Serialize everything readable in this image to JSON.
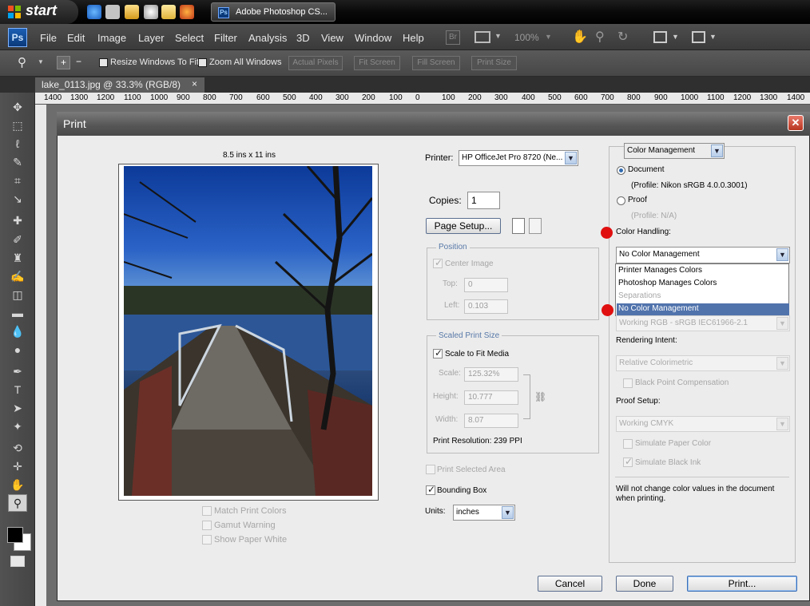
{
  "taskbar": {
    "start_label": "start",
    "task_label": "Adobe Photoshop CS...",
    "task_icon": "Ps"
  },
  "menubar": {
    "logo": "Ps",
    "items": [
      "File",
      "Edit",
      "Image",
      "Layer",
      "Select",
      "Filter",
      "Analysis",
      "3D",
      "View",
      "Window",
      "Help"
    ],
    "bridge": "Br",
    "zoom": "100%"
  },
  "options": {
    "resize_windows": "Resize Windows To Fit",
    "zoom_all": "Zoom All Windows",
    "actual_pixels": "Actual Pixels",
    "fit_screen": "Fit Screen",
    "fill_screen": "Fill Screen",
    "print_size": "Print Size"
  },
  "document": {
    "tab_title": "lake_0113.jpg @ 33.3% (RGB/8)",
    "close": "×",
    "ruler": [
      "1400",
      "1300",
      "1200",
      "1100",
      "1000",
      "900",
      "800",
      "700",
      "600",
      "500",
      "400",
      "300",
      "200",
      "100",
      "0",
      "100",
      "200",
      "300",
      "400",
      "500",
      "600",
      "700",
      "800",
      "900",
      "1000",
      "1100",
      "1200",
      "1300",
      "1400"
    ]
  },
  "dialog": {
    "title": "Print",
    "close": "✕",
    "page_size": "8.5 ins x 11 ins",
    "printer_label": "Printer:",
    "printer_value": "HP OfficeJet Pro 8720 (Ne...",
    "copies_label": "Copies:",
    "copies_value": "1",
    "page_setup": "Page Setup...",
    "position": {
      "title": "Position",
      "center_image": "Center Image",
      "top_label": "Top:",
      "top_value": "0",
      "left_label": "Left:",
      "left_value": "0.103"
    },
    "scaled": {
      "title": "Scaled Print Size",
      "scale_to_fit": "Scale to Fit Media",
      "scale_label": "Scale:",
      "scale_value": "125.32%",
      "height_label": "Height:",
      "height_value": "10.777",
      "width_label": "Width:",
      "width_value": "8.07",
      "resolution": "Print Resolution: 239 PPI"
    },
    "print_selected": "Print Selected Area",
    "bounding_box": "Bounding Box",
    "units_label": "Units:",
    "units_value": "inches",
    "match_colors": "Match Print Colors",
    "gamut_warning": "Gamut Warning",
    "paper_white": "Show Paper White",
    "color_section": "Color Management",
    "document_label": "Document",
    "document_profile": "(Profile: Nikon sRGB 4.0.0.3001)",
    "proof_label": "Proof",
    "proof_profile": "(Profile: N/A)",
    "color_handling": "Color Handling:",
    "color_handling_value": "No Color Management",
    "dropdown_options": [
      "Printer Manages Colors",
      "Photoshop Manages Colors",
      "Separations",
      "No Color Management"
    ],
    "printer_profile_value": "Working RGB - sRGB IEC61966-2.1",
    "rendering_label": "Rendering Intent:",
    "rendering_value": "Relative Colorimetric",
    "black_point": "Black Point Compensation",
    "proof_setup": "Proof Setup:",
    "proof_setup_value": "Working CMYK",
    "sim_paper": "Simulate Paper Color",
    "sim_black": "Simulate Black Ink",
    "note": "Will not change color values in the document when printing.",
    "cancel": "Cancel",
    "done": "Done",
    "print": "Print..."
  }
}
